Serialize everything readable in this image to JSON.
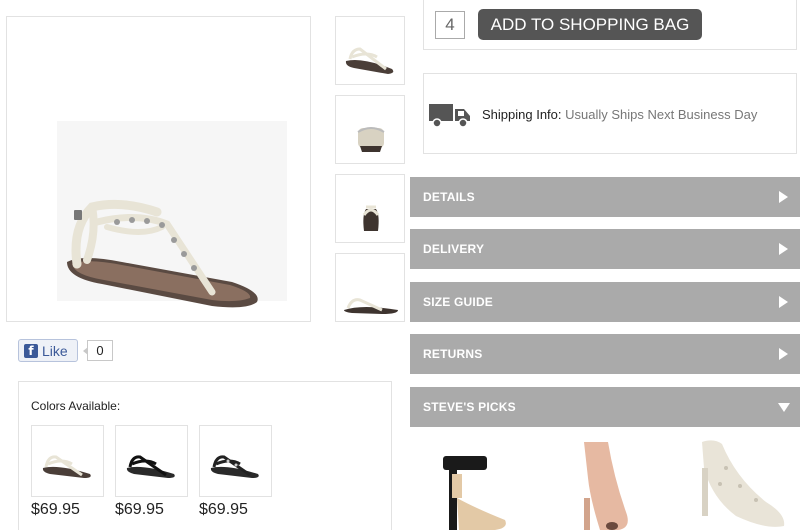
{
  "cart": {
    "quantity": "4",
    "add_button": "ADD TO SHOPPING BAG"
  },
  "shipping": {
    "label": "Shipping Info:",
    "value": "Usually Ships Next Business Day"
  },
  "accordion": {
    "items": [
      {
        "label": "DETAILS",
        "expanded": false
      },
      {
        "label": "DELIVERY",
        "expanded": false
      },
      {
        "label": "SIZE GUIDE",
        "expanded": false
      },
      {
        "label": "RETURNS",
        "expanded": false
      },
      {
        "label": "STEVE'S PICKS",
        "expanded": true
      }
    ]
  },
  "social": {
    "like_label": "Like",
    "like_count": "0"
  },
  "colors": {
    "title": "Colors Available:",
    "swatches": [
      {
        "color": "bone",
        "price": "$69.95"
      },
      {
        "color": "black",
        "price": "$69.95"
      },
      {
        "color": "black-silver",
        "price": "$69.95"
      }
    ]
  },
  "palette": {
    "accordion_bg": "#aaaaaa",
    "button_bg": "#555555",
    "facebook_blue": "#3b5998"
  }
}
